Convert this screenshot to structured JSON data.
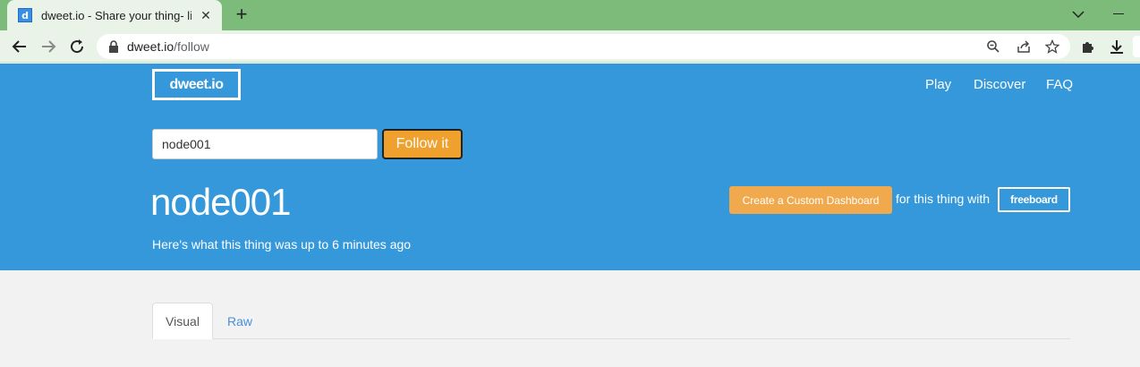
{
  "browser": {
    "tab_title": "dweet.io - Share your thing- like",
    "favicon_letter": "d",
    "url_host": "dweet.io",
    "url_path": "/follow"
  },
  "hero": {
    "brand": "dweet.io",
    "nav": [
      "Play",
      "Discover",
      "FAQ"
    ],
    "follow_input_value": "node001",
    "follow_button": "Follow it",
    "thing_name": "node001",
    "subtitle": "Here's what this thing was up to 6 minutes ago",
    "dashboard_button": "Create a Custom Dashboard",
    "dashboard_text": "for this thing with",
    "freeboard_label": "freeboard"
  },
  "tabs": [
    "Visual",
    "Raw"
  ],
  "colors": {
    "hero_bg": "#3598db",
    "accent_orange": "#f0a02c",
    "chrome_green": "#7cbb79",
    "link_blue": "#4a90d9"
  }
}
